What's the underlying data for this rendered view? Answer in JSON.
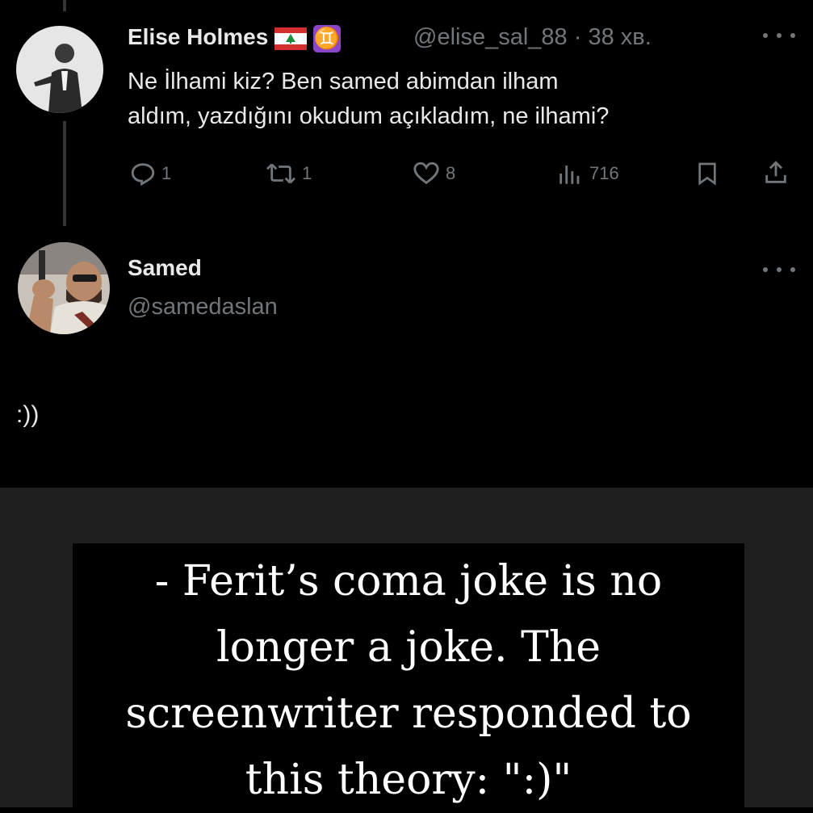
{
  "tweet1": {
    "author_name": "Elise Holmes",
    "flag_icon": "lebanon-flag-icon",
    "zodiac_symbol": "♊",
    "handle": "@elise_sal_88",
    "separator": "·",
    "time": "38 хв.",
    "text_line1": "Ne İlhami kiz? Ben samed abimdan ilham",
    "text_line2": "aldım, yazdığını okudum açıkladım, ne ilhami?",
    "replies": "1",
    "retweets": "1",
    "likes": "8",
    "views": "716"
  },
  "tweet2": {
    "author_name": "Samed",
    "handle": "@samedaslan",
    "text": ":))"
  },
  "caption": {
    "line1": "- Ferit’s coma joke is no",
    "line2": "longer a joke. The",
    "line3": "screenwriter responded to",
    "line4": "this theory: \":)\""
  },
  "colors": {
    "background": "#000000",
    "text": "#e7e9ea",
    "muted": "#71767b",
    "lower_background": "#1f1f1f",
    "zodiac_badge": "#8c44c9"
  }
}
